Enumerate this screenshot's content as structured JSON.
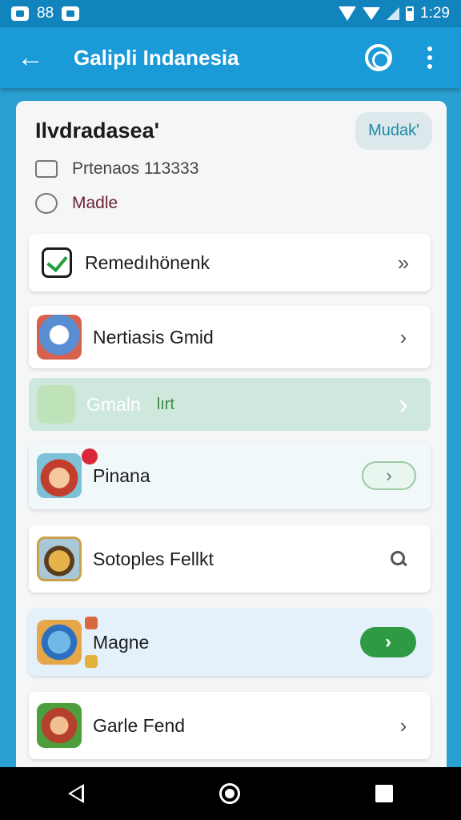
{
  "status_bar": {
    "left_text": "88",
    "time": "1:29"
  },
  "app_bar": {
    "back_icon": "arrow-left",
    "title": "Galipli Indanesia",
    "action_icon": "gear-icon",
    "more_icon": "more-vert"
  },
  "profile": {
    "name": "Ilvdradasea'",
    "action_label": "Mudak'",
    "meta_1": "Prtenaos 113333",
    "meta_2": "Madle"
  },
  "list": [
    {
      "label": "Remedıhönenk",
      "action": "»"
    },
    {
      "label": "Nertiasis Gmid",
      "action": "›"
    },
    {
      "label": "Gmaln",
      "extra": "lırt",
      "action": "›"
    },
    {
      "label": "Pinana",
      "action": "›"
    },
    {
      "label": "Sotoples Fellkt",
      "action": "search"
    },
    {
      "label": "Magne",
      "action": "›"
    },
    {
      "label": "Garle Fend",
      "action": "›"
    }
  ],
  "colors": {
    "app_bar": "#1a9ad6",
    "status_bar": "#1284bd",
    "accent_green": "#2e9a44"
  }
}
